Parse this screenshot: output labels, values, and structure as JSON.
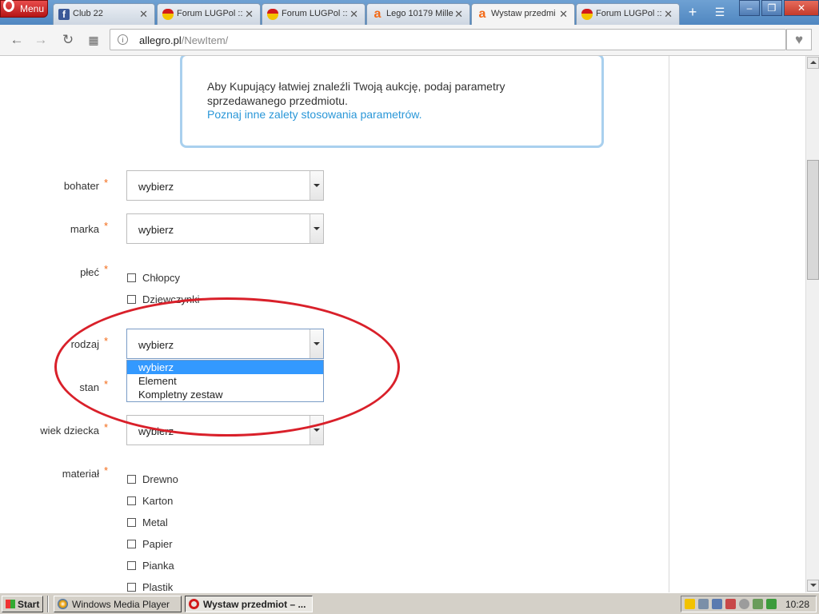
{
  "browser": {
    "menu_label": "Menu",
    "tabs": [
      {
        "title": "Club 22",
        "favicon": "facebook-icon"
      },
      {
        "title": "Forum LUGPol :: ",
        "favicon": "lugpol-icon"
      },
      {
        "title": "Forum LUGPol :: ",
        "favicon": "lugpol-icon"
      },
      {
        "title": "Lego 10179 Mille",
        "favicon": "allegro-icon"
      },
      {
        "title": "Wystaw przedmi",
        "favicon": "allegro-icon",
        "active": true
      },
      {
        "title": "Forum LUGPol :: ",
        "favicon": "lugpol-icon"
      }
    ],
    "url_host": "allegro.pl",
    "url_path": "/NewItem/"
  },
  "page": {
    "info_text": "Aby Kupujący łatwiej znaleźli Twoją aukcję, podaj parametry sprzedawanego przedmiotu.",
    "info_link": "Poznaj inne zalety stosowania parametrów.",
    "required_mark": "*",
    "fields": {
      "bohater": {
        "label": "bohater",
        "value": "wybierz"
      },
      "marka": {
        "label": "marka",
        "value": "wybierz"
      },
      "plec": {
        "label": "płeć",
        "options": [
          "Chłopcy",
          "Dziewczynki"
        ]
      },
      "rodzaj": {
        "label": "rodzaj",
        "value": "wybierz",
        "dropdown_options": [
          "wybierz",
          "Element",
          "Kompletny zestaw"
        ],
        "selected_option": "wybierz"
      },
      "stan": {
        "label": "stan"
      },
      "wiek": {
        "label": "wiek dziecka",
        "value": "wybierz"
      },
      "material": {
        "label": "materiał",
        "options": [
          "Drewno",
          "Karton",
          "Metal",
          "Papier",
          "Pianka",
          "Plastik"
        ]
      }
    },
    "annotation_color": "#d9202a",
    "accent_color": "#f36a17",
    "link_color": "#2a97d8"
  },
  "taskbar": {
    "start_label": "Start",
    "tasks": [
      {
        "label": "Windows Media Player"
      },
      {
        "label": "Wystaw przedmiot – ...",
        "active": true
      }
    ],
    "clock": "10:28"
  }
}
